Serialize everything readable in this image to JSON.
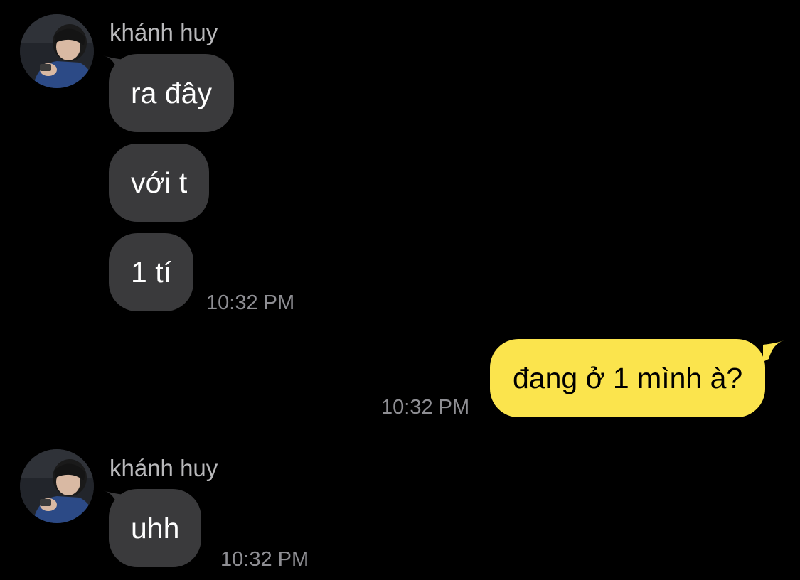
{
  "colors": {
    "background": "#000000",
    "incoming_bubble": "#3a3a3c",
    "outgoing_bubble": "#fbe44d",
    "sender_name": "#b9b9bb",
    "timestamp": "#8e8e93"
  },
  "messages": [
    {
      "sender": "khánh huy",
      "avatar_icon": "user-photo-avatar",
      "bubbles": [
        "ra đây",
        "với t",
        "1 tí"
      ],
      "time": "10:32 PM"
    },
    {
      "outgoing": true,
      "bubbles": [
        "đang ở 1 mình à?"
      ],
      "time": "10:32 PM"
    },
    {
      "sender": "khánh huy",
      "avatar_icon": "user-photo-avatar",
      "bubbles": [
        "uhh"
      ],
      "time": "10:32 PM"
    }
  ]
}
